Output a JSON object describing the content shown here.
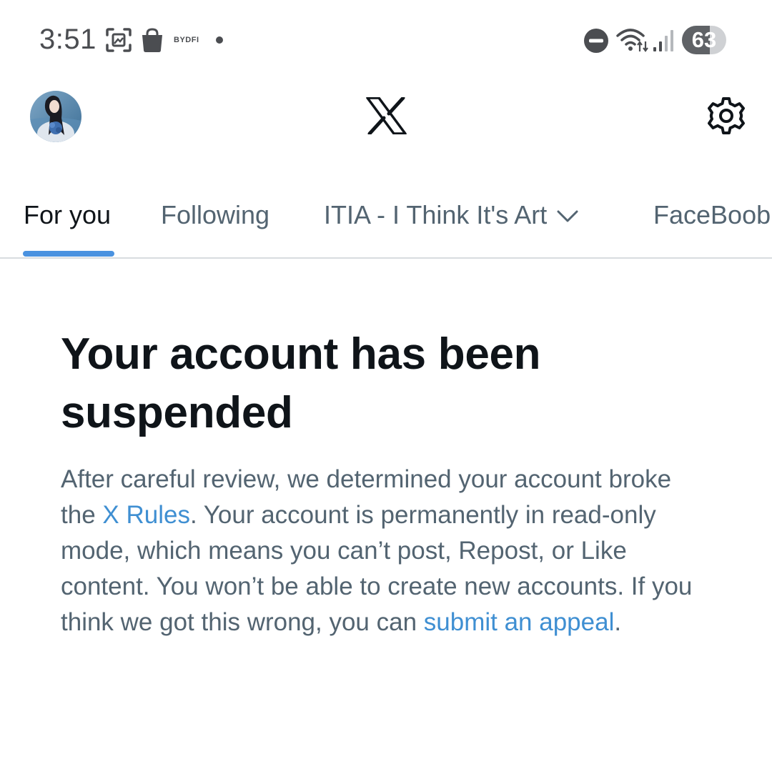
{
  "status_bar": {
    "time": "3:51",
    "app_label": "BYDFI",
    "battery": "63",
    "battery_level": 0.63,
    "icons": [
      "screenshot-icon",
      "shopping-bag-icon",
      "notification-dot-icon",
      "do-not-disturb-icon",
      "wifi-icon",
      "signal-icon",
      "battery-icon"
    ]
  },
  "header": {
    "logo": "x-logo-icon",
    "settings": "gear-icon"
  },
  "tabs": [
    {
      "label": "For you",
      "active": true
    },
    {
      "label": "Following",
      "active": false
    },
    {
      "label": "ITIA - I Think It's Art",
      "active": false,
      "has_dropdown": true
    },
    {
      "label": "FaceBoob",
      "active": false
    }
  ],
  "notice": {
    "title": "Your account has been suspended",
    "body_part1": "After careful review, we determined your account broke the ",
    "rules_link": "X Rules",
    "body_part2": ". Your account is permanently in read-only mode, which means you can’t post, Repost, or Like content. You won’t be able to create new accounts. If you think we got this wrong, you can ",
    "appeal_link": "submit an appeal",
    "body_part3": "."
  },
  "colors": {
    "accent": "#4a92e0",
    "link": "#3f8fd2",
    "text_primary": "#0f1419",
    "text_secondary": "#536471"
  }
}
